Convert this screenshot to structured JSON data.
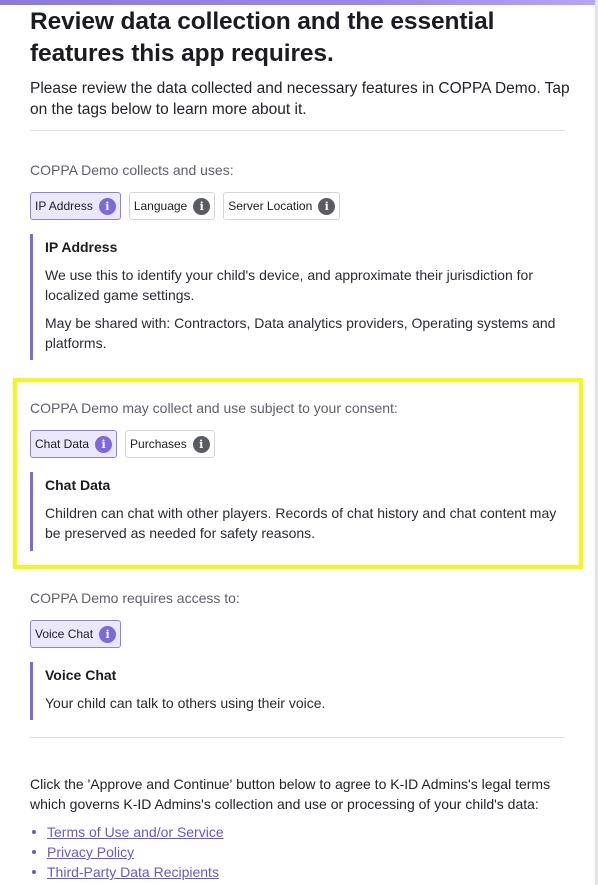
{
  "header": {
    "title": "Review data collection and the essential features this app requires.",
    "intro": "Please review the data collected and necessary features in COPPA Demo. Tap on the tags below to learn more about it."
  },
  "collects": {
    "label": "COPPA Demo collects and uses:",
    "tags": [
      "IP Address",
      "Language",
      "Server Location"
    ],
    "detail": {
      "title": "IP Address",
      "text": "We use this to identify your child's device, and approximate their jurisdiction for localized game settings.",
      "shared": "May be shared with: Contractors, Data analytics providers, Operating systems and platforms."
    }
  },
  "consent": {
    "label": "COPPA Demo may collect and use subject to your consent:",
    "tags": [
      "Chat Data",
      "Purchases"
    ],
    "detail": {
      "title": "Chat Data",
      "text": "Children can chat with other players. Records of chat history and chat content may be preserved as needed for safety reasons."
    }
  },
  "requires": {
    "label": "COPPA Demo requires access to:",
    "tags": [
      "Voice Chat"
    ],
    "detail": {
      "title": "Voice Chat",
      "text": "Your child can talk to others using their voice."
    }
  },
  "footer": {
    "text": "Click the 'Approve and Continue' button below to agree to K-ID Admins's legal terms which governs K-ID Admins's collection and use or processing of your child's data:",
    "links": [
      "Terms of Use and/or Service",
      "Privacy Policy",
      "Third-Party Data Recipients"
    ]
  },
  "icons": {
    "info": "info-icon"
  },
  "colors": {
    "accent": "#7d68dc",
    "highlight": "#f7f51a",
    "link": "#6a58c8"
  }
}
